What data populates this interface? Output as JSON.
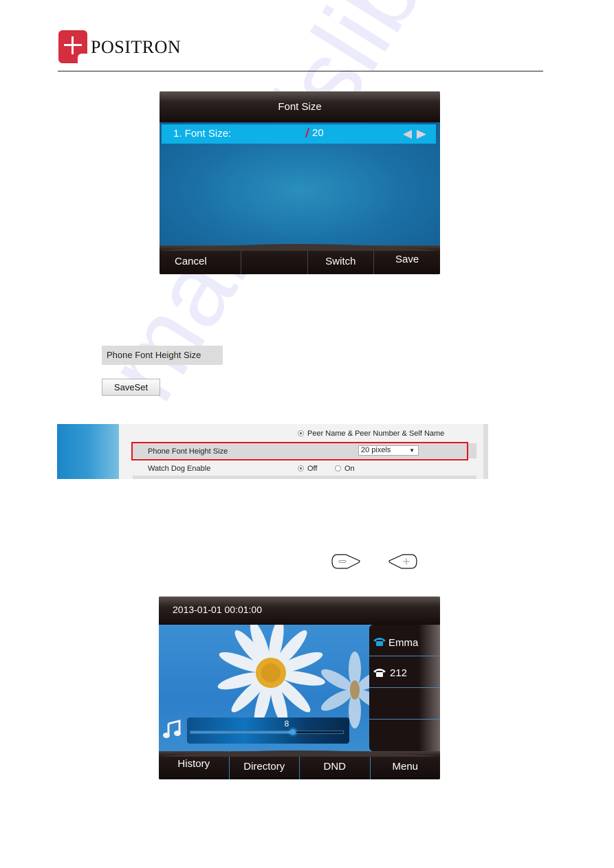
{
  "header": {
    "brand": "POSITRON",
    "brand_color": "#d42e3f"
  },
  "watermark": "manualslib.com",
  "font_size_screen": {
    "title": "Font Size",
    "item_label": "1. Font Size:",
    "item_value": "20",
    "input_icon": "pencil-icon",
    "arrows_icon": "left-right-arrows-icon",
    "highlight_color": "#0eb0e8",
    "softkeys": [
      "Cancel",
      "",
      "Switch",
      "Save"
    ]
  },
  "web_ui_items": {
    "field_label": "Phone Font Height Size",
    "save_button": "SaveSet"
  },
  "web_ui_panel": {
    "row_top": {
      "option_label": "Peer Name & Peer Number & Self Name",
      "selected": true
    },
    "row_font": {
      "label": "Phone Font Height Size",
      "select_value": "20 pixels"
    },
    "row_watchdog": {
      "label": "Watch Dog Enable",
      "options": [
        "Off",
        "On"
      ],
      "selected": "Off"
    },
    "highlight_box_color": "#e0141e"
  },
  "volume_keys": {
    "minus": "volume-down-key-icon",
    "plus": "volume-up-key-icon"
  },
  "idle_screen": {
    "datetime": "2013-01-01 00:01:00",
    "lines": [
      {
        "label": "Emma",
        "icon": "phone-icon",
        "icon_color": "#1da1dc"
      },
      {
        "label": "212",
        "icon": "phone-icon",
        "icon_color": "#ffffff"
      },
      {
        "label": ""
      },
      {
        "label": ""
      }
    ],
    "volume": {
      "value": "8",
      "level_fraction": 0.67,
      "icon": "music-note-icon"
    },
    "softkeys": [
      "History",
      "Directory",
      "DND",
      "Menu"
    ]
  }
}
